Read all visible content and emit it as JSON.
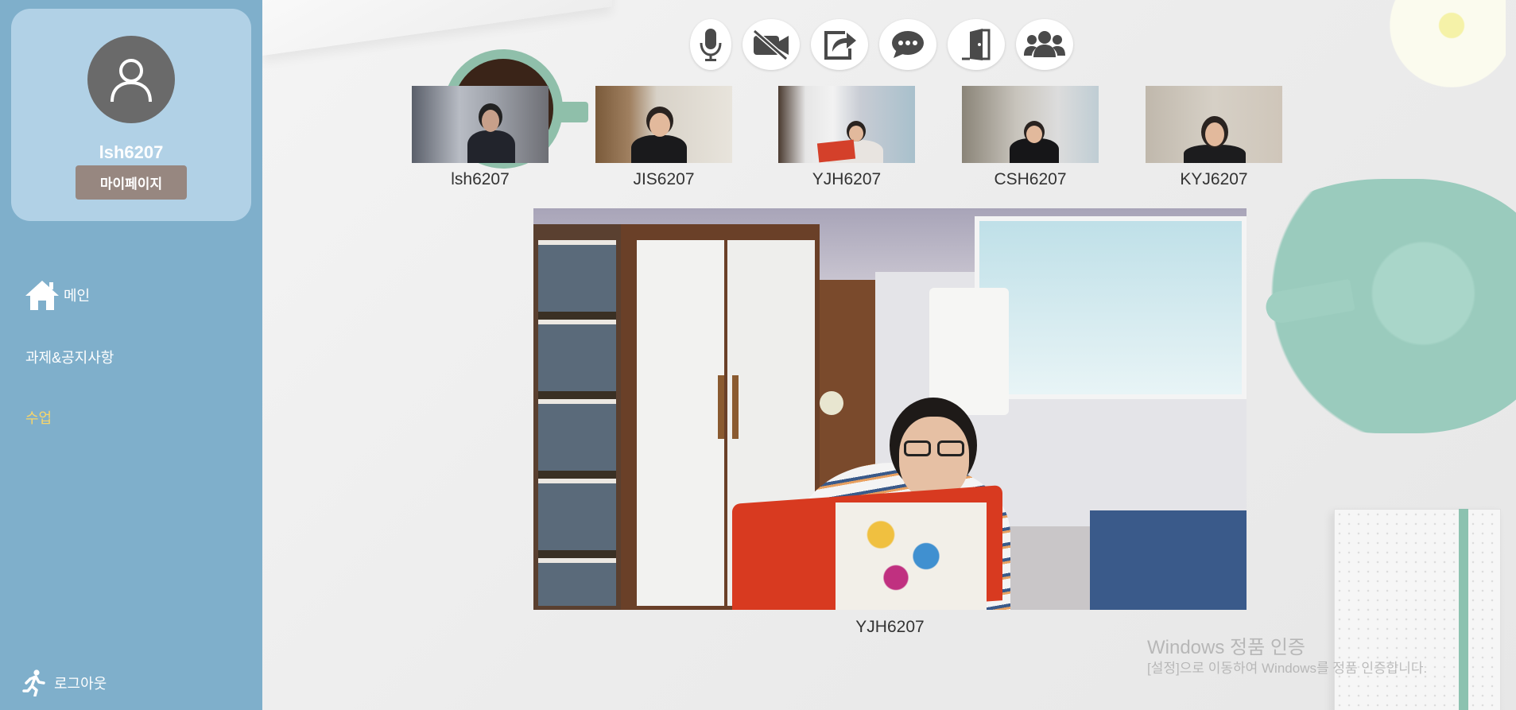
{
  "profile": {
    "username": "lsh6207",
    "mypage_label": "마이페이지",
    "avatar_icon": "user-icon"
  },
  "nav": {
    "main": {
      "label": "메인",
      "icon": "home-icon"
    },
    "assignments": {
      "label": "과제&공지사항"
    },
    "class": {
      "label": "수업",
      "active": true,
      "color": "#f7d56a"
    },
    "logout": {
      "label": "로그아웃",
      "icon": "running-icon"
    }
  },
  "toolbar": {
    "buttons": [
      {
        "name": "microphone",
        "icon": "microphone-icon"
      },
      {
        "name": "camera-off",
        "icon": "video-off-icon"
      },
      {
        "name": "share",
        "icon": "share-icon"
      },
      {
        "name": "chat",
        "icon": "chat-icon"
      },
      {
        "name": "exit",
        "icon": "door-exit-icon"
      },
      {
        "name": "participants",
        "icon": "users-icon"
      }
    ]
  },
  "participants": [
    {
      "name": "lsh6207"
    },
    {
      "name": "JIS6207"
    },
    {
      "name": "YJH6207"
    },
    {
      "name": "CSH6207"
    },
    {
      "name": "KYJ6207"
    }
  ],
  "main_video": {
    "name": "YJH6207"
  },
  "watermark": {
    "title": "Windows 정품 인증",
    "subtitle": "[설정]으로 이동하여 Windows를 정품 인증합니다."
  },
  "colors": {
    "sidebar": "#7fafcb",
    "profile_card": "#b1d1e6",
    "mypage_button": "#978780",
    "active_nav": "#f7d56a"
  }
}
